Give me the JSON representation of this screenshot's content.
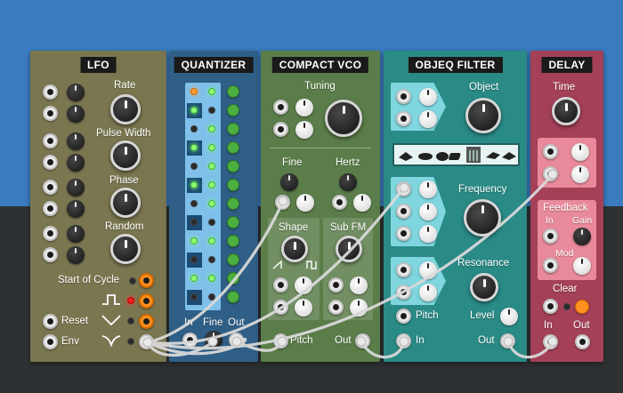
{
  "modules": {
    "lfo": {
      "title": "LFO",
      "rate": "Rate",
      "pulse_width": "Pulse Width",
      "phase": "Phase",
      "random": "Random",
      "start_of_cycle": "Start of Cycle",
      "reset": "Reset",
      "env": "Env"
    },
    "quantizer": {
      "title": "QUANTIZER",
      "in": "In",
      "fine": "Fine",
      "out": "Out"
    },
    "vco": {
      "title": "COMPACT VCO",
      "tuning": "Tuning",
      "fine": "Fine",
      "hertz": "Hertz",
      "shape": "Shape",
      "sub_fm": "Sub FM",
      "pitch": "Pitch",
      "out": "Out"
    },
    "filter": {
      "title": "OBJEQ FILTER",
      "object": "Object",
      "frequency": "Frequency",
      "resonance": "Resonance",
      "pitch": "Pitch",
      "level": "Level",
      "in": "In",
      "out": "Out"
    },
    "delay": {
      "title": "DELAY",
      "time": "Time",
      "feedback": "Feedback",
      "fb_in": "In",
      "fb_gain": "Gain",
      "mod": "Mod",
      "clear": "Clear",
      "in": "In",
      "out": "Out"
    }
  },
  "colors": {
    "lfo_panel": "#7a7650",
    "quantizer_panel": "#2f5f86",
    "vco_panel": "#5b7d4a",
    "filter_panel": "#2a8a86",
    "delay_panel": "#a44058",
    "cable": "#e4e4e4"
  }
}
